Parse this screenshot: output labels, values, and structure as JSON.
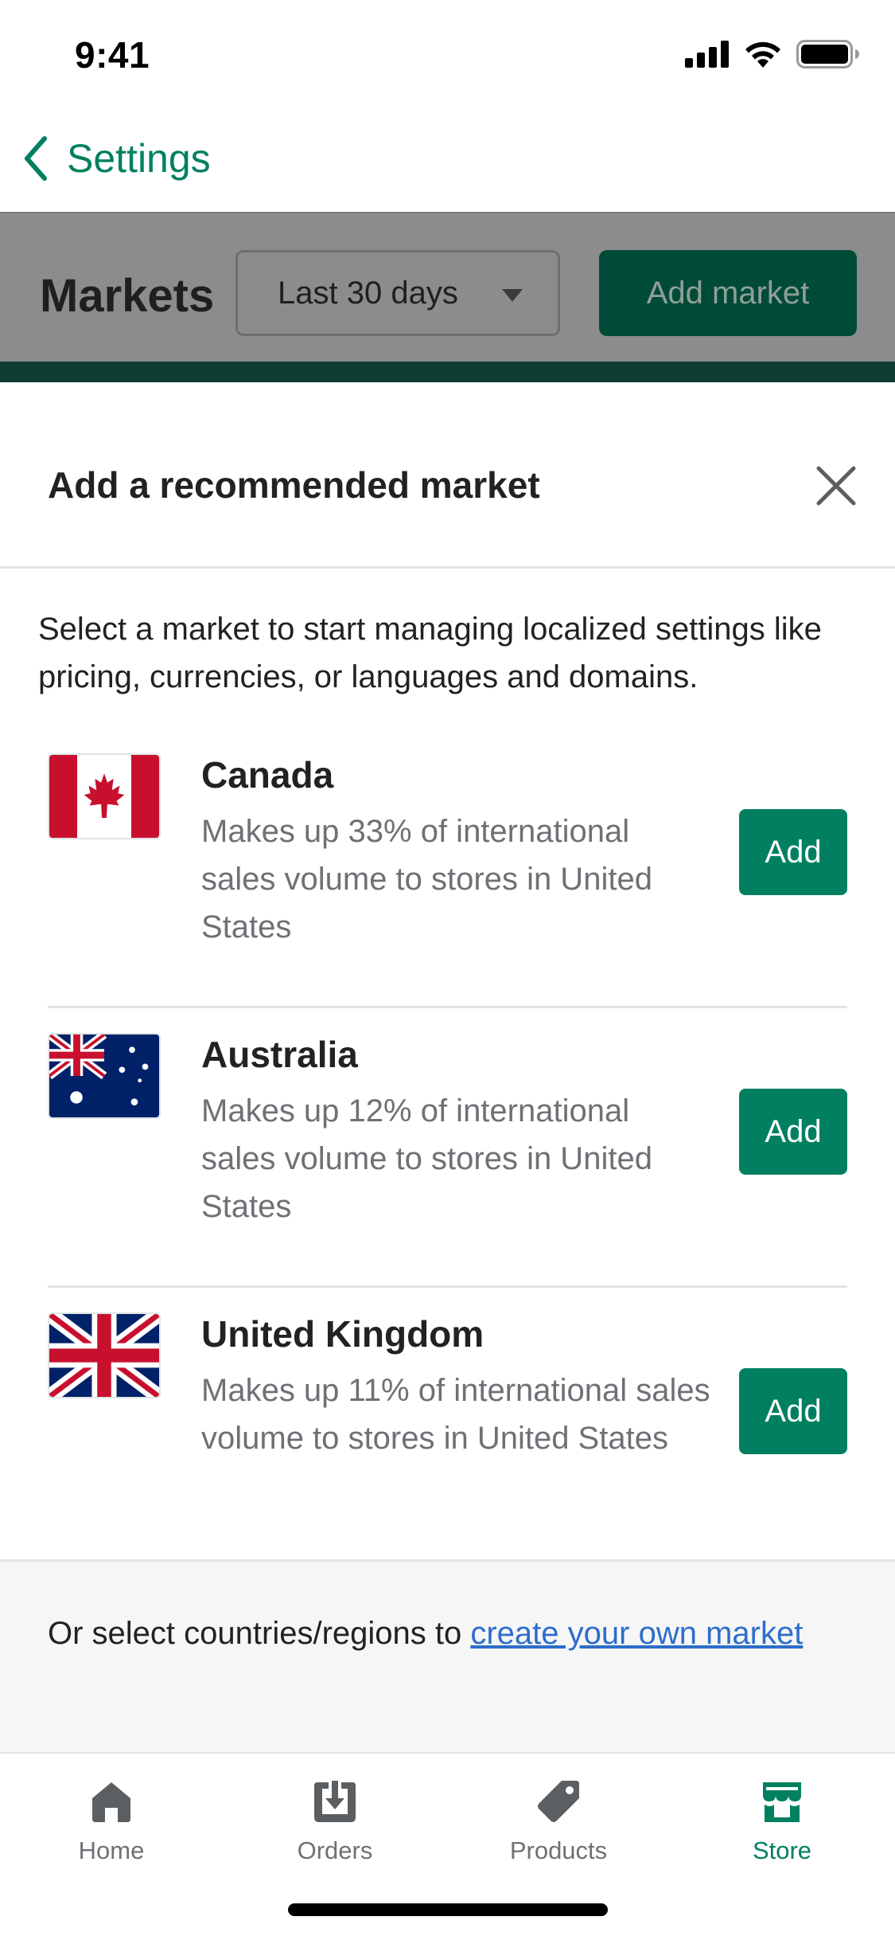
{
  "status_bar": {
    "time": "9:41"
  },
  "nav": {
    "back_label": "Settings"
  },
  "background_page": {
    "title": "Markets",
    "date_filter": "Last 30 days",
    "add_market_label": "Add market"
  },
  "sheet": {
    "title": "Add a recommended market",
    "intro": "Select a market to start managing localized settings like pricing, currencies, or languages and domains.",
    "markets": [
      {
        "name": "Canada",
        "description": "Makes up 33% of international sales volume to stores in United States",
        "add_label": "Add",
        "flag": "canada-flag"
      },
      {
        "name": "Australia",
        "description": "Makes up 12% of international sales volume to stores in United States",
        "add_label": "Add",
        "flag": "australia-flag"
      },
      {
        "name": "United Kingdom",
        "description": "Makes up 11% of international sales volume to stores in United States",
        "add_label": "Add",
        "flag": "uk-flag"
      }
    ],
    "footer_prefix": "Or select countries/regions to ",
    "footer_link": "create your own market"
  },
  "tabs": [
    {
      "label": "Home",
      "icon": "home-icon"
    },
    {
      "label": "Orders",
      "icon": "orders-icon"
    },
    {
      "label": "Products",
      "icon": "tag-icon"
    },
    {
      "label": "Store",
      "icon": "store-icon",
      "active": true
    }
  ],
  "colors": {
    "primary": "#008060",
    "primary_dark": "#004b37",
    "text": "#202223",
    "subdued": "#6d7175",
    "link": "#2c6ecb"
  }
}
